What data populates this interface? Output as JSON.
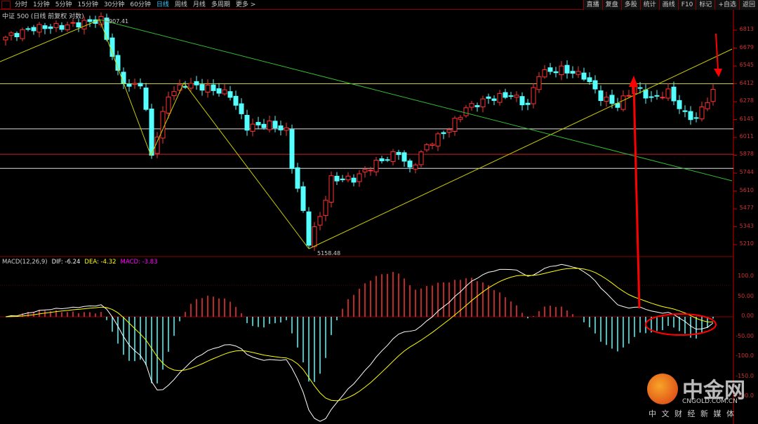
{
  "toolbar": {
    "items": [
      "分时",
      "1分钟",
      "5分钟",
      "15分钟",
      "30分钟",
      "60分钟",
      "日线",
      "周线",
      "月线",
      "多周期",
      "更多 >"
    ],
    "active": "日线",
    "right_items": [
      "直播",
      "复盘",
      "多股",
      "统计",
      "画线",
      "F10",
      "标记",
      "+自选",
      "返回"
    ]
  },
  "title": "中证 500 (日线 前复权 对数)",
  "colors": {
    "up": "#ff3232",
    "down": "#54ffff",
    "dif": "#ffffff",
    "dea": "#ffff00",
    "grid": "#8b0000"
  },
  "chart_data": {
    "type": "candlestick",
    "price_axis": {
      "ticks": [
        "6813",
        "6679",
        "6545",
        "6412",
        "6278",
        "6145",
        "6011",
        "5878",
        "5744",
        "5610",
        "5477",
        "5343",
        "5210"
      ],
      "range": [
        5150,
        6950
      ]
    },
    "high_label": "6907.41",
    "low_label": "5158.48",
    "price_keypoints": [
      [
        0,
        6760
      ],
      [
        5,
        6830
      ],
      [
        10,
        6840
      ],
      [
        17,
        6890
      ],
      [
        20,
        6490
      ],
      [
        22,
        6385
      ],
      [
        24,
        6420
      ],
      [
        25,
        6200
      ],
      [
        26,
        5880
      ],
      [
        29,
        6330
      ],
      [
        32,
        6410
      ],
      [
        36,
        6380
      ],
      [
        40,
        6330
      ],
      [
        43,
        6090
      ],
      [
        47,
        6110
      ],
      [
        50,
        6060
      ],
      [
        51,
        5800
      ],
      [
        53,
        5450
      ],
      [
        54,
        5230
      ],
      [
        56,
        5420
      ],
      [
        58,
        5700
      ],
      [
        62,
        5700
      ],
      [
        66,
        5820
      ],
      [
        70,
        5900
      ],
      [
        72,
        5770
      ],
      [
        75,
        5950
      ],
      [
        79,
        6080
      ],
      [
        82,
        6230
      ],
      [
        86,
        6300
      ],
      [
        90,
        6330
      ],
      [
        93,
        6250
      ],
      [
        95,
        6490
      ],
      [
        99,
        6520
      ],
      [
        103,
        6470
      ],
      [
        106,
        6310
      ],
      [
        109,
        6250
      ],
      [
        112,
        6390
      ],
      [
        115,
        6300
      ],
      [
        118,
        6350
      ],
      [
        121,
        6180
      ],
      [
        123,
        6150
      ],
      [
        126,
        6370
      ]
    ],
    "horizontal_levels": [
      6412,
      6075,
      5885,
      5780
    ],
    "macd": {
      "label": "MACD(12,26,9)",
      "dif": "DIF: -6.24",
      "dea": "DEA: -4.32",
      "macd": "MACD: -3.83",
      "axis_ticks": [
        "100.0",
        "50.00",
        "0.00",
        "-50.00",
        "-100.0",
        "-150.0",
        "-200.0"
      ]
    }
  },
  "watermark": {
    "name": "中金网",
    "domain": "CNGOLD.COM.CN",
    "tagline": "中 文 财 经 新 媒 体"
  }
}
